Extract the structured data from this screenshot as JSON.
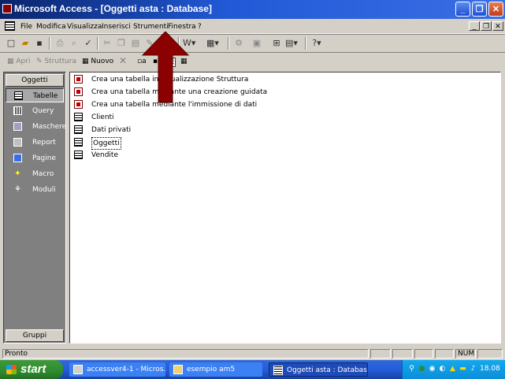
{
  "window": {
    "title": "Microsoft Access - [Oggetti asta : Database]",
    "minimize_glyph": "_",
    "maximize_glyph": "❐",
    "close_glyph": "✕"
  },
  "menubar": {
    "items": [
      "File",
      "Modifica",
      "Visualizza",
      "Inserisci",
      "Strumenti",
      "Finestra",
      "?"
    ],
    "mdi_buttons": [
      "_",
      "❐",
      "✕"
    ]
  },
  "toolbar": {
    "icons": [
      "new-icon",
      "open-icon",
      "save-icon",
      "print-icon",
      "print-preview-icon",
      "spelling-icon",
      "cut-icon",
      "copy-icon",
      "paste-icon",
      "format-painter-icon",
      "undo-icon",
      "office-links-icon",
      "analyze-icon",
      "code-icon",
      "properties-icon",
      "relationships-icon",
      "new-object-icon",
      "help-icon"
    ]
  },
  "db_toolbar": {
    "open_label": "Apri",
    "design_label": "Struttura",
    "new_label": "Nuovo"
  },
  "sidebar": {
    "header": "Oggetti",
    "items": [
      {
        "label": "Tabelle",
        "icon": "table-icon",
        "selected": true
      },
      {
        "label": "Query",
        "icon": "query-icon",
        "selected": false
      },
      {
        "label": "Maschere",
        "icon": "form-icon",
        "selected": false
      },
      {
        "label": "Report",
        "icon": "report-icon",
        "selected": false
      },
      {
        "label": "Pagine",
        "icon": "page-icon",
        "selected": false
      },
      {
        "label": "Macro",
        "icon": "macro-icon",
        "selected": false
      },
      {
        "label": "Moduli",
        "icon": "module-icon",
        "selected": false
      }
    ],
    "footer": "Gruppi"
  },
  "list": {
    "items": [
      {
        "label": "Crea una tabella in visualizzazione Struttura",
        "icon": "wizard-icon"
      },
      {
        "label": "Crea una tabella mediante una creazione guidata",
        "icon": "wizard-icon"
      },
      {
        "label": "Crea una tabella mediante l'immissione di dati",
        "icon": "wizard-icon"
      },
      {
        "label": "Clienti",
        "icon": "table-icon"
      },
      {
        "label": "Dati privati",
        "icon": "table-icon"
      },
      {
        "label": "Oggetti",
        "icon": "table-icon",
        "focused": true
      },
      {
        "label": "Vendite",
        "icon": "table-icon"
      }
    ]
  },
  "statusbar": {
    "status": "Pronto",
    "num": "NUM"
  },
  "taskbar": {
    "start_label": "start",
    "tasks": [
      {
        "label": "accessver4-1 - Micros...",
        "active": false
      },
      {
        "label": "esempio am5",
        "active": false
      },
      {
        "label": "Oggetti asta : Database",
        "active": true
      }
    ],
    "clock": "18.08"
  },
  "colors": {
    "titlebar": "#0a246a",
    "arrow": "#8b0000",
    "sidebar": "#808080",
    "taskbar": "#245ddb",
    "start": "#2f8a2f"
  }
}
